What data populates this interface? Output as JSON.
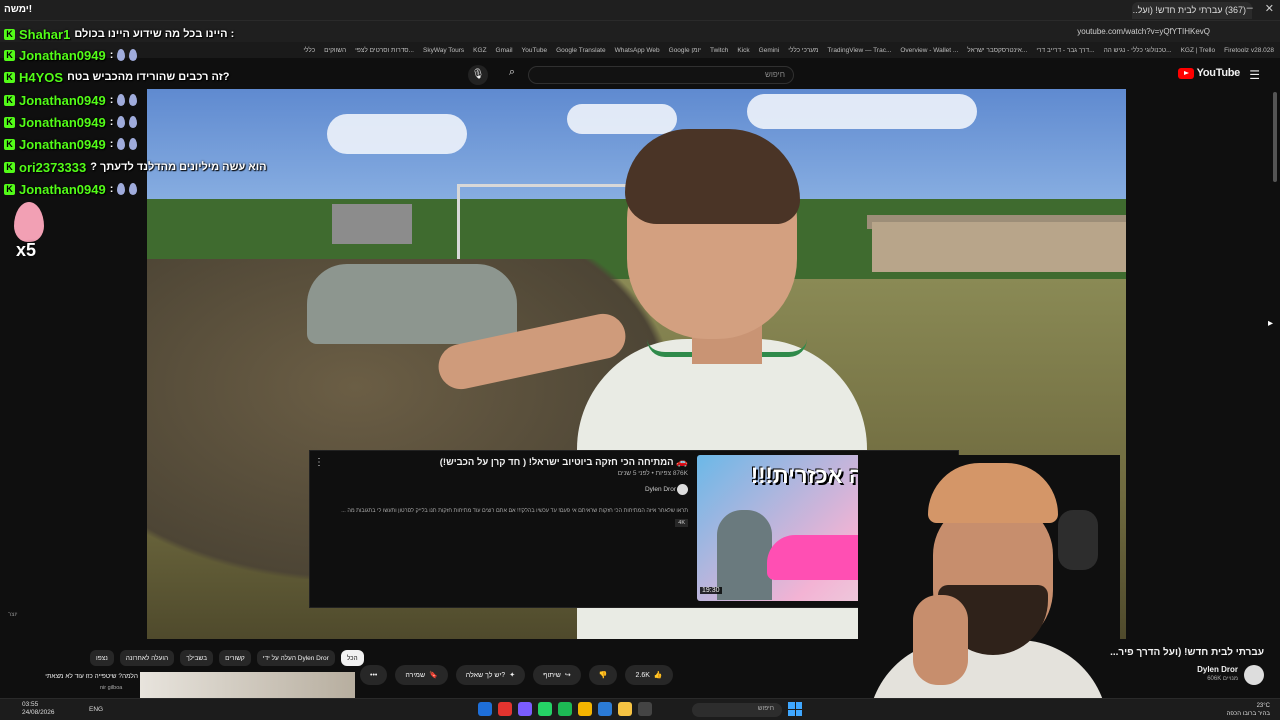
{
  "browser": {
    "logo_text": "ימשה!",
    "active_tab": "(367) עברתי לבית חדש! (ועל...",
    "url": "youtube.com/watch?v=yQfYTIHKevQ",
    "bookmarks": [
      "כללי",
      "השווקים",
      "סדרות וסרטים לצפי...",
      "SkyWay Tours",
      "KGZ",
      "Gmail",
      "YouTube",
      "Google Translate",
      "WhatsApp Web",
      "Google יומן",
      "Twitch",
      "Kick",
      "Gemini",
      "מערכי כללי",
      "TradingView — Trac...",
      "Overview - Wallet ...",
      "אינטרסקסבר ישראל...",
      "דרך גבר - דרייב דרי...",
      "טכנולוגי כללי - נגיש הה...",
      "KGZ | Trello",
      "Firetoolz v28.028"
    ]
  },
  "youtube": {
    "logo": "YouTube",
    "search_placeholder": "חיפוש",
    "video_title": "עברתי לבית חדש! (ועל הדרך פיר...",
    "channel": "Dylen Dror",
    "subscribers": "606K מנויים",
    "likes": "2.6K",
    "actions": [
      "שיתוף",
      "יש לך שאלה?",
      "שמירה"
    ],
    "chips": [
      "הכל",
      "העלה על ידי Dylen Dror",
      "קשורים",
      "בשבילך",
      "הועלה לאחרונה",
      "נצפו"
    ],
    "rec_title": "הלמה? שיטפייה כזו עוד לא מצאתי",
    "rec_channel": "nir gilboa"
  },
  "card": {
    "title": "🚗 המתיחה הכי חזקה ביוטיוב ישראל! ( חד קרן על הכביש!)",
    "views": "876K צפיות • לפני 5 שנים",
    "channel": "Dylen Dror",
    "description": "תראו שלאחר איזה המתיחות הכי חזקות שראיתם אי פעם! עד עכשיו בהלק!!! אם אתם רוצים עוד מתיחות חזקות תנו בלייק לסרטון ותעשו לי בתגובות מה ...",
    "badge": "4K",
    "thumb_text": "נקמה אכזרית!!!",
    "duration": "19:30"
  },
  "chat": [
    {
      "name": "Shahar1",
      "message": "היינו בכל מה שידוע היינו בכולם :"
    },
    {
      "name": "Jonathan0949",
      "message": ":"
    },
    {
      "name": "H4YOS",
      "message": "זה רכבים שהורידו מהכביש בטח?"
    },
    {
      "name": "Jonathan0949",
      "message": ":"
    },
    {
      "name": "Jonathan0949",
      "message": ":"
    },
    {
      "name": "Jonathan0949",
      "message": ":"
    },
    {
      "name": "ori2373333",
      "message": "? הוא עשה מיליונים מהדלנד לדעתך"
    },
    {
      "name": "Jonathan0949",
      "message": ":"
    }
  ],
  "gift_count": "x5",
  "watermark": "יוצר",
  "taskbar": {
    "time": "03:55",
    "date": "24/08/2026",
    "lang": "ENG",
    "search": "חיפוש",
    "weather": "23°C",
    "weather_desc": "בהיר ברובו הכפה"
  },
  "colors": {
    "kick_green": "#53fc18",
    "yt_red": "#ff0000",
    "bg": "#0f0f0f"
  }
}
